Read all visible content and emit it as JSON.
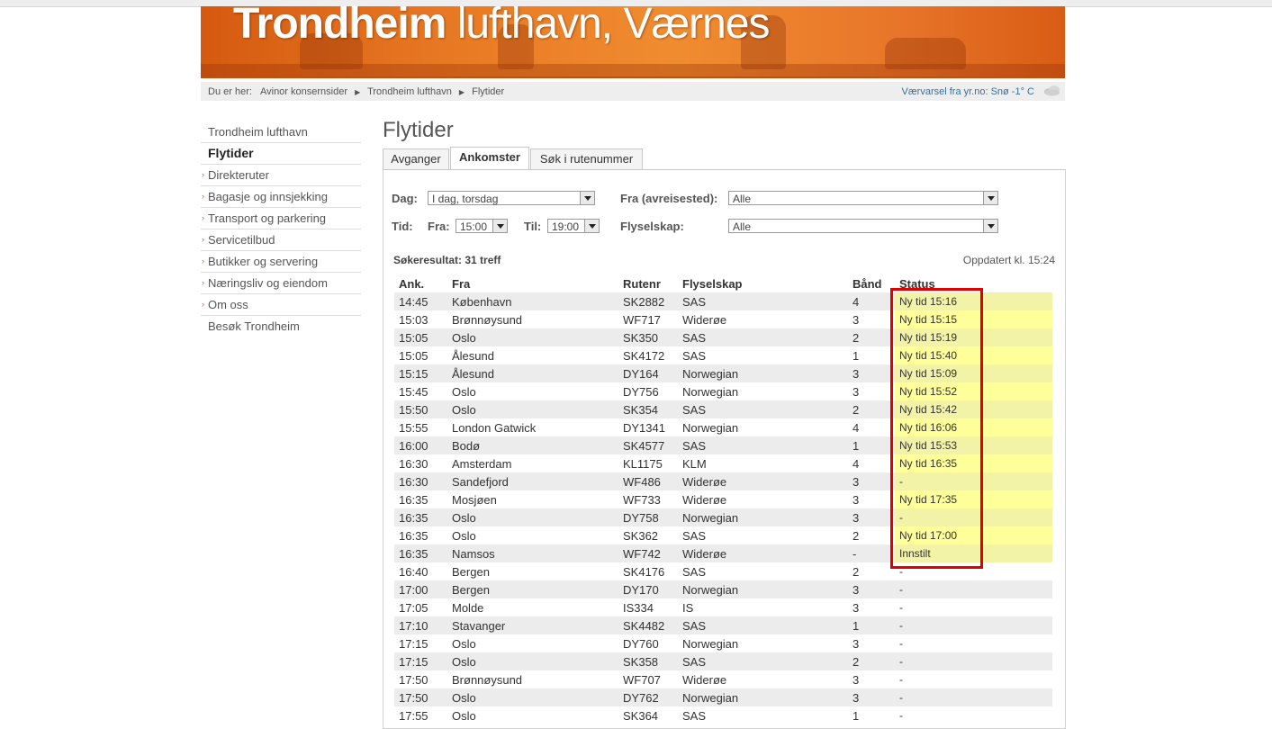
{
  "banner": {
    "title_bold": "Trondheim",
    "title_rest": "lufthavn, Værnes"
  },
  "breadcrumb": {
    "prefix": "Du er her:",
    "items": [
      "Avinor konsernsider",
      "Trondheim lufthavn",
      "Flytider"
    ]
  },
  "weather": {
    "text": "Værvarsel fra yr.no:  Snø -1° C",
    "icon": "cloud-icon"
  },
  "sidebar": {
    "items": [
      {
        "label": "Trondheim lufthavn",
        "type": "top"
      },
      {
        "label": "Flytider",
        "type": "active"
      },
      {
        "label": "Direkteruter",
        "type": "sub"
      },
      {
        "label": "Bagasje og innsjekking",
        "type": "sub"
      },
      {
        "label": "Transport og parkering",
        "type": "sub"
      },
      {
        "label": "Servicetilbud",
        "type": "sub"
      },
      {
        "label": "Butikker og servering",
        "type": "sub"
      },
      {
        "label": "Næringsliv og eiendom",
        "type": "sub"
      },
      {
        "label": "Om oss",
        "type": "sub"
      },
      {
        "label": "Besøk Trondheim",
        "type": "top"
      }
    ]
  },
  "page": {
    "title": "Flytider"
  },
  "tabs": [
    "Avganger",
    "Ankomster",
    "Søk i rutenummer"
  ],
  "filters": {
    "dag_label": "Dag:",
    "dag_value": "I dag, torsdag",
    "fra_label": "Fra (avreisested):",
    "fra_value": "Alle",
    "tid_label": "Tid:",
    "tid_fra_label": "Fra:",
    "tid_fra_value": "15:00",
    "tid_til_label": "Til:",
    "tid_til_value": "19:00",
    "flyselskap_label": "Flyselskap:",
    "flyselskap_value": "Alle"
  },
  "results": {
    "count_text": "Søkeresultat: 31 treff",
    "updated_text": "Oppdatert kl. 15:24"
  },
  "table": {
    "headers": [
      "Ank.",
      "Fra",
      "Rutenr",
      "Flyselskap",
      "Bånd",
      "Status"
    ],
    "rows": [
      {
        "ank": "14:45",
        "fra": "København",
        "rute": "SK2882",
        "selskap": "SAS",
        "band": "4",
        "status": "Ny tid 15:16",
        "hl": true
      },
      {
        "ank": "15:03",
        "fra": "Brønnøysund",
        "rute": "WF717",
        "selskap": "Widerøe",
        "band": "3",
        "status": "Ny tid 15:15",
        "hl": true
      },
      {
        "ank": "15:05",
        "fra": "Oslo",
        "rute": "SK350",
        "selskap": "SAS",
        "band": "2",
        "status": "Ny tid 15:19",
        "hl": true
      },
      {
        "ank": "15:05",
        "fra": "Ålesund",
        "rute": "SK4172",
        "selskap": "SAS",
        "band": "1",
        "status": "Ny tid 15:40",
        "hl": true
      },
      {
        "ank": "15:15",
        "fra": "Ålesund",
        "rute": "DY164",
        "selskap": "Norwegian",
        "band": "3",
        "status": "Ny tid 15:09",
        "hl": true
      },
      {
        "ank": "15:45",
        "fra": "Oslo",
        "rute": "DY756",
        "selskap": "Norwegian",
        "band": "3",
        "status": "Ny tid 15:52",
        "hl": true
      },
      {
        "ank": "15:50",
        "fra": "Oslo",
        "rute": "SK354",
        "selskap": "SAS",
        "band": "2",
        "status": "Ny tid 15:42",
        "hl": true
      },
      {
        "ank": "15:55",
        "fra": "London Gatwick",
        "rute": "DY1341",
        "selskap": "Norwegian",
        "band": "4",
        "status": "Ny tid 16:06",
        "hl": true
      },
      {
        "ank": "16:00",
        "fra": "Bodø",
        "rute": "SK4577",
        "selskap": "SAS",
        "band": "1",
        "status": "Ny tid 15:53",
        "hl": true
      },
      {
        "ank": "16:30",
        "fra": "Amsterdam",
        "rute": "KL1175",
        "selskap": "KLM",
        "band": "4",
        "status": "Ny tid 16:35",
        "hl": true
      },
      {
        "ank": "16:30",
        "fra": "Sandefjord",
        "rute": "WF486",
        "selskap": "Widerøe",
        "band": "3",
        "status": "-",
        "hl": true
      },
      {
        "ank": "16:35",
        "fra": "Mosjøen",
        "rute": "WF733",
        "selskap": "Widerøe",
        "band": "3",
        "status": "Ny tid 17:35",
        "hl": true
      },
      {
        "ank": "16:35",
        "fra": "Oslo",
        "rute": "DY758",
        "selskap": "Norwegian",
        "band": "3",
        "status": "-",
        "hl": true
      },
      {
        "ank": "16:35",
        "fra": "Oslo",
        "rute": "SK362",
        "selskap": "SAS",
        "band": "2",
        "status": "Ny tid 17:00",
        "hl": true
      },
      {
        "ank": "16:35",
        "fra": "Namsos",
        "rute": "WF742",
        "selskap": "Widerøe",
        "band": "-",
        "status": "Innstilt",
        "hl": true
      },
      {
        "ank": "16:40",
        "fra": "Bergen",
        "rute": "SK4176",
        "selskap": "SAS",
        "band": "2",
        "status": "-",
        "hl": false
      },
      {
        "ank": "17:00",
        "fra": "Bergen",
        "rute": "DY170",
        "selskap": "Norwegian",
        "band": "3",
        "status": "-",
        "hl": false
      },
      {
        "ank": "17:05",
        "fra": "Molde",
        "rute": "IS334",
        "selskap": "IS",
        "band": "3",
        "status": "-",
        "hl": false
      },
      {
        "ank": "17:10",
        "fra": "Stavanger",
        "rute": "SK4482",
        "selskap": "SAS",
        "band": "1",
        "status": "-",
        "hl": false
      },
      {
        "ank": "17:15",
        "fra": "Oslo",
        "rute": "DY760",
        "selskap": "Norwegian",
        "band": "3",
        "status": "-",
        "hl": false
      },
      {
        "ank": "17:15",
        "fra": "Oslo",
        "rute": "SK358",
        "selskap": "SAS",
        "band": "2",
        "status": "-",
        "hl": false
      },
      {
        "ank": "17:50",
        "fra": "Brønnøysund",
        "rute": "WF707",
        "selskap": "Widerøe",
        "band": "3",
        "status": "-",
        "hl": false
      },
      {
        "ank": "17:50",
        "fra": "Oslo",
        "rute": "DY762",
        "selskap": "Norwegian",
        "band": "3",
        "status": "-",
        "hl": false
      },
      {
        "ank": "17:55",
        "fra": "Oslo",
        "rute": "SK364",
        "selskap": "SAS",
        "band": "1",
        "status": "-",
        "hl": false
      }
    ]
  },
  "colors": {
    "brand_orange": "#e8762a",
    "highlight": "#ffff99",
    "annotation_red": "#e00000",
    "link_blue": "#3a6e9a"
  }
}
